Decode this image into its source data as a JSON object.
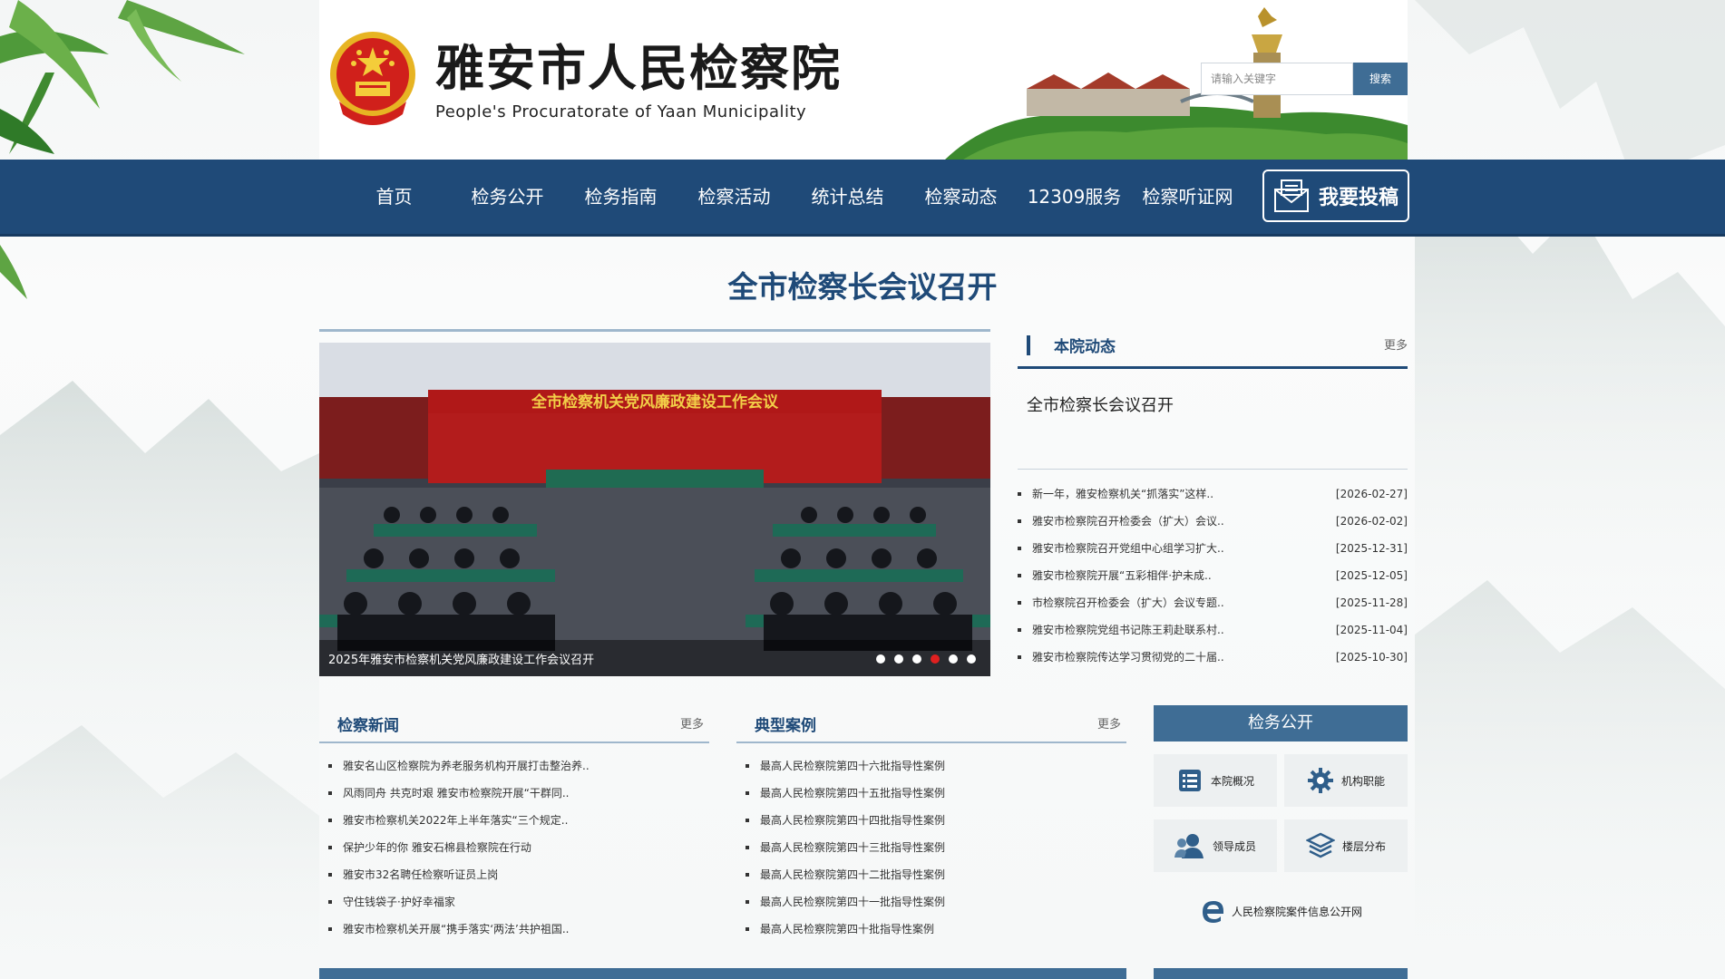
{
  "header": {
    "title": "雅安市人民检察院",
    "subtitle": "People's Procuratorate of Yaan  Municipality",
    "search_placeholder": "请输入关键字",
    "search_button": "搜索"
  },
  "nav": {
    "items": [
      "首页",
      "检务公开",
      "检务指南",
      "检察活动",
      "统计总结",
      "检察动态",
      "12309服务",
      "检察听证网"
    ],
    "submit_label": "我要投稿"
  },
  "headline": "全市检察长会议召开",
  "slider": {
    "caption": "2025年雅安市检察机关党风廉政建设工作会议召开",
    "banner_text": "全市检察机关党风廉政建设工作会议",
    "dot_count": 6,
    "active_dot": 4
  },
  "dynamic": {
    "title": "本院动态",
    "more": "更多",
    "top_item": "全市检察长会议召开",
    "items": [
      {
        "text": "新一年，雅安检察机关“抓落实”这样..",
        "date": "[2026-02-27]"
      },
      {
        "text": "雅安市检察院召开检委会（扩大）会议..",
        "date": "[2026-02-02]"
      },
      {
        "text": "雅安市检察院召开党组中心组学习扩大..",
        "date": "[2025-12-31]"
      },
      {
        "text": "雅安市检察院开展“五彩相伴·护未成..",
        "date": "[2025-12-05]"
      },
      {
        "text": "市检察院召开检委会（扩大）会议专题..",
        "date": "[2025-11-28]"
      },
      {
        "text": "雅安市检察院党组书记陈王莉赴联系村..",
        "date": "[2025-11-04]"
      },
      {
        "text": "雅安市检察院传达学习贯彻党的二十届..",
        "date": "[2025-10-30]"
      }
    ]
  },
  "news": {
    "title": "检察新闻",
    "more": "更多",
    "items": [
      "雅安名山区检察院为养老服务机构开展打击整治养..",
      "风雨同舟 共克时艰 雅安市检察院开展“干群同..",
      "雅安市检察机关2022年上半年落实“三个规定..",
      "保护少年的你 雅安石棉县检察院在行动",
      "雅安市32名聘任检察听证员上岗",
      "守住钱袋子·护好幸福家",
      "雅安市检察机关开展“携手落实‘两法’共护祖国.."
    ]
  },
  "cases": {
    "title": "典型案例",
    "more": "更多",
    "items": [
      "最高人民检察院第四十六批指导性案例",
      "最高人民检察院第四十五批指导性案例",
      "最高人民检察院第四十四批指导性案例",
      "最高人民检察院第四十三批指导性案例",
      "最高人民检察院第四十二批指导性案例",
      "最高人民检察院第四十一批指导性案例",
      "最高人民检察院第四十批指导性案例"
    ]
  },
  "public": {
    "title": "检务公开",
    "tiles": [
      {
        "label": "本院概况",
        "icon": "document-list-icon"
      },
      {
        "label": "机构职能",
        "icon": "gear-icon"
      },
      {
        "label": "领导成员",
        "icon": "users-icon"
      },
      {
        "label": "楼层分布",
        "icon": "layers-icon"
      }
    ],
    "wide_link": "人民检察院案件信息公开网",
    "wide_icon": "ie-e-icon"
  },
  "colors": {
    "nav_bg": "#1f4a78",
    "accent": "#3f6d95",
    "headline": "#1f4a78",
    "active_dot": "#e02020"
  }
}
